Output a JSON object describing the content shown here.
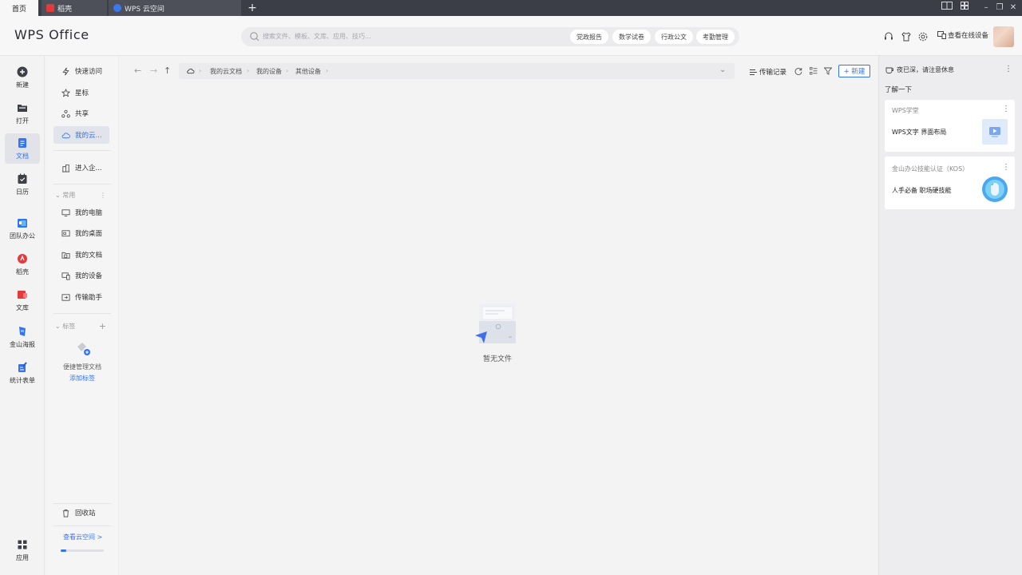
{
  "tabs": [
    {
      "label": "首页"
    },
    {
      "label": "稻壳"
    },
    {
      "label": "WPS 云空间"
    }
  ],
  "header": {
    "logo": "WPS Office",
    "search_placeholder": "搜索文件、模板、文库、应用、技巧...",
    "chips": [
      "党政报告",
      "数学试卷",
      "行政公文",
      "考勤管理"
    ],
    "online_devices": "查看在线设备"
  },
  "rail": {
    "items": [
      {
        "label": "新建",
        "icon": "plus-circle-icon"
      },
      {
        "label": "打开",
        "icon": "folder-icon"
      },
      {
        "label": "文档",
        "icon": "document-icon"
      },
      {
        "label": "日历",
        "icon": "calendar-icon"
      },
      {
        "label": "团队办公",
        "icon": "team-icon"
      },
      {
        "label": "稻壳",
        "icon": "docer-icon"
      },
      {
        "label": "文库",
        "icon": "library-icon"
      },
      {
        "label": "金山海报",
        "icon": "poster-icon"
      },
      {
        "label": "统计表单",
        "icon": "form-icon"
      },
      {
        "label": "应用",
        "icon": "apps-grid-icon"
      }
    ]
  },
  "nav": {
    "quick": "快速访问",
    "starred": "星标",
    "shared": "共享",
    "mycloud": "我的云...",
    "enterprise": "进入企...",
    "common_section": "常用",
    "common": [
      "我的电脑",
      "我的桌面",
      "我的文档",
      "我的设备",
      "传输助手"
    ],
    "tags_section": "标签",
    "tag_hint": "便捷管理文档",
    "tag_add": "添加标签",
    "recycle": "回收站",
    "cloud_space": "查看云空间 >"
  },
  "main": {
    "breadcrumbs": [
      "我的云文档",
      "我的设备",
      "其他设备"
    ],
    "transfer": "传输记录",
    "new_btn": "+ 新建",
    "empty": "暂无文件"
  },
  "right": {
    "notice": "夜已深，请注意休息",
    "learn": "了解一下",
    "cards": [
      {
        "title": "WPS学堂",
        "text": "WPS文字 界面布局"
      },
      {
        "title": "金山办公技能认证（KOS）",
        "text": "人手必备 职场硬技能"
      }
    ]
  },
  "colors": {
    "accent": "#3474f2",
    "tabbar": "#3b3e47"
  }
}
